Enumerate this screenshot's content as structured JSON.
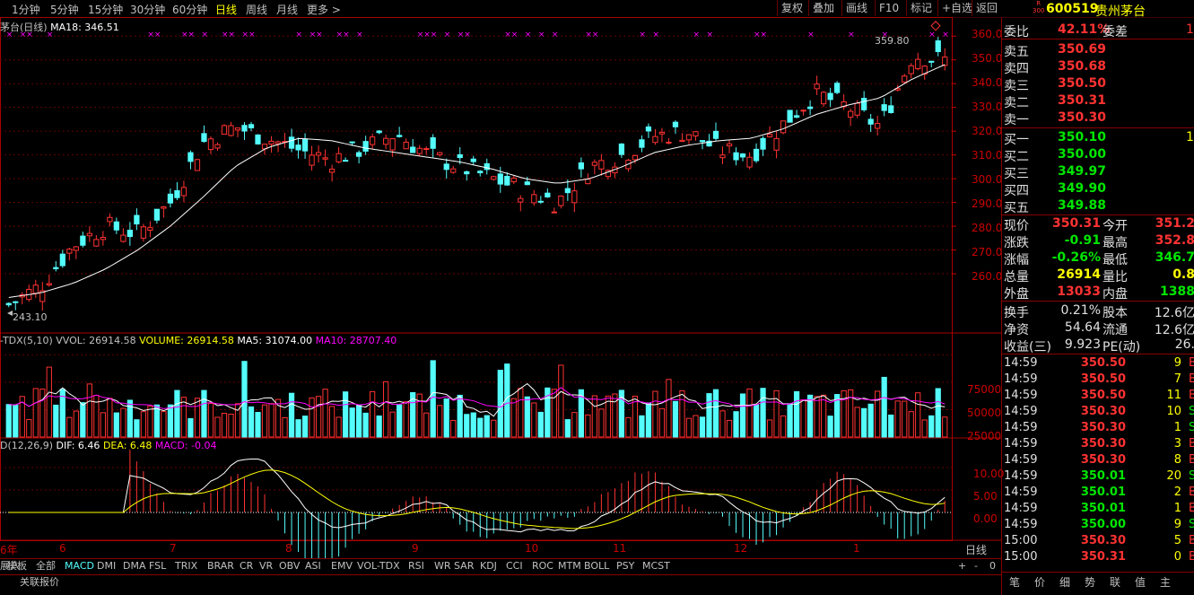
{
  "topbar": {
    "periods": [
      "1分钟",
      "5分钟",
      "15分钟",
      "30分钟",
      "60分钟",
      "日线",
      "周线",
      "月线",
      "更多 >"
    ],
    "active_period": "日线",
    "right_buttons": [
      "复权",
      "叠加",
      "画线",
      "F10",
      "标记",
      "+自选",
      "返回"
    ]
  },
  "stock": {
    "badge_r": "R",
    "badge_300": "300",
    "code": "600519",
    "name": "贵州茅台"
  },
  "main_chart": {
    "legend_name": "茅台(日线)",
    "legend_ma": "MA18: 346.51",
    "high_label": "359.80",
    "low_label": "243.10",
    "price_ticks": [
      "360.0",
      "350.0",
      "340.0",
      "330.0",
      "320.0",
      "310.0",
      "300.0",
      "290.0",
      "280.0",
      "270.0",
      "260.0"
    ]
  },
  "volume_chart": {
    "legend_name": "-TDX(5,10)",
    "legend_vvol": "VVOL: 26914.58",
    "legend_volume": "VOLUME: 26914.58",
    "legend_ma5": "MA5: 31074.00",
    "legend_ma10": "MA10: 28707.40",
    "ticks": [
      "75000",
      "50000",
      "25000"
    ]
  },
  "macd_chart": {
    "legend_name": "D(12,26,9)",
    "legend_dif": "DIF: 6.46",
    "legend_dea": "DEA: 6.48",
    "legend_macd": "MACD: -0.04",
    "ticks": [
      "10.00",
      "5.00",
      "0.00"
    ]
  },
  "xaxis": {
    "labels": [
      "6年",
      "6",
      "7",
      "8",
      "9",
      "10",
      "11",
      "12",
      "1"
    ],
    "right_label": "日线"
  },
  "chart_data": {
    "type": "line",
    "title": "茅台(日线)",
    "ylim": [
      240,
      365
    ],
    "series": [
      {
        "name": "MA18",
        "values": [
          250,
          252,
          256,
          262,
          270,
          280,
          292,
          305,
          313,
          317,
          316,
          313,
          311,
          309,
          307,
          304,
          300,
          298,
          300,
          305,
          311,
          314,
          316,
          317,
          321,
          327,
          331,
          334,
          342,
          348
        ]
      }
    ],
    "close_values": [
      247,
      255,
      272,
      280,
      277,
      290,
      315,
      322,
      317,
      312,
      308,
      313,
      319,
      310,
      305,
      300,
      295,
      290,
      305,
      310,
      318,
      320,
      312,
      310,
      323,
      336,
      330,
      322,
      352,
      350
    ]
  },
  "quote": {
    "weibi_label": "委比",
    "weibi_value": "42.11%",
    "weicha_label": "委差",
    "weicha_value": "1",
    "sells": [
      {
        "label": "卖五",
        "price": "350.69"
      },
      {
        "label": "卖四",
        "price": "350.68"
      },
      {
        "label": "卖三",
        "price": "350.50"
      },
      {
        "label": "卖二",
        "price": "350.31"
      },
      {
        "label": "卖一",
        "price": "350.30"
      }
    ],
    "buys": [
      {
        "label": "买一",
        "price": "350.10",
        "vol": "1"
      },
      {
        "label": "买二",
        "price": "350.00",
        "vol": ""
      },
      {
        "label": "买三",
        "price": "349.97",
        "vol": ""
      },
      {
        "label": "买四",
        "price": "349.90",
        "vol": ""
      },
      {
        "label": "买五",
        "price": "349.88",
        "vol": ""
      }
    ],
    "stats": [
      {
        "l1": "现价",
        "v1": "350.31",
        "c1": "red",
        "l2": "今开",
        "v2": "351.2",
        "c2": "red"
      },
      {
        "l1": "涨跌",
        "v1": "-0.91",
        "c1": "green",
        "l2": "最高",
        "v2": "352.8",
        "c2": "red"
      },
      {
        "l1": "涨幅",
        "v1": "-0.26%",
        "c1": "green",
        "l2": "最低",
        "v2": "346.7",
        "c2": "green"
      },
      {
        "l1": "总量",
        "v1": "26914",
        "c1": "gold",
        "l2": "量比",
        "v2": "0.8",
        "c2": "gold"
      },
      {
        "l1": "外盘",
        "v1": "13033",
        "c1": "red",
        "l2": "内盘",
        "v2": "1388",
        "c2": "green"
      }
    ],
    "stats2": [
      {
        "l1": "换手",
        "v1": "0.21%",
        "l2": "股本",
        "v2": "12.6亿"
      },
      {
        "l1": "净资",
        "v1": "54.64",
        "l2": "流通",
        "v2": "12.6亿"
      },
      {
        "l1": "收益(三)",
        "v1": "9.923",
        "l2": "PE(动)",
        "v2": "26."
      }
    ],
    "ticks": [
      {
        "time": "14:59",
        "price": "350.50",
        "vol": "9",
        "bs": "B"
      },
      {
        "time": "14:59",
        "price": "350.50",
        "vol": "7",
        "bs": "B"
      },
      {
        "time": "14:59",
        "price": "350.50",
        "vol": "11",
        "bs": "B"
      },
      {
        "time": "14:59",
        "price": "350.30",
        "vol": "10",
        "bs": "S"
      },
      {
        "time": "14:59",
        "price": "350.30",
        "vol": "1",
        "bs": "S"
      },
      {
        "time": "14:59",
        "price": "350.30",
        "vol": "3",
        "bs": "B"
      },
      {
        "time": "14:59",
        "price": "350.30",
        "vol": "8",
        "bs": "B"
      },
      {
        "time": "14:59",
        "price": "350.01",
        "vol": "20",
        "bs": "S"
      },
      {
        "time": "14:59",
        "price": "350.01",
        "vol": "2",
        "bs": "B"
      },
      {
        "time": "14:59",
        "price": "350.01",
        "vol": "1",
        "bs": "B"
      },
      {
        "time": "14:59",
        "price": "350.00",
        "vol": "9",
        "bs": "S"
      },
      {
        "time": "15:00",
        "price": "350.30",
        "vol": "5",
        "bs": "B"
      },
      {
        "time": "15:00",
        "price": "350.31",
        "vol": "0",
        "bs": "B"
      }
    ],
    "bottom_tabs": [
      "笔",
      "价",
      "细",
      "势",
      "联",
      "值",
      "主"
    ]
  },
  "indicator_tabs": [
    "模板",
    "全部",
    "MACD",
    "DMI",
    "DMA",
    "FSL",
    "TRIX",
    "BRAR",
    "CR",
    "VR",
    "OBV",
    "ASI",
    "EMV",
    "VOL-TDX",
    "RSI",
    "WR",
    "SAR",
    "KDJ",
    "CCI",
    "ROC",
    "MTM",
    "BOLL",
    "PSY",
    "MCST"
  ],
  "active_indicator": "MACD",
  "bottom_bar": {
    "related": "关联报价",
    "left_char": "展八",
    "controls": [
      "+",
      "-",
      "0"
    ]
  }
}
